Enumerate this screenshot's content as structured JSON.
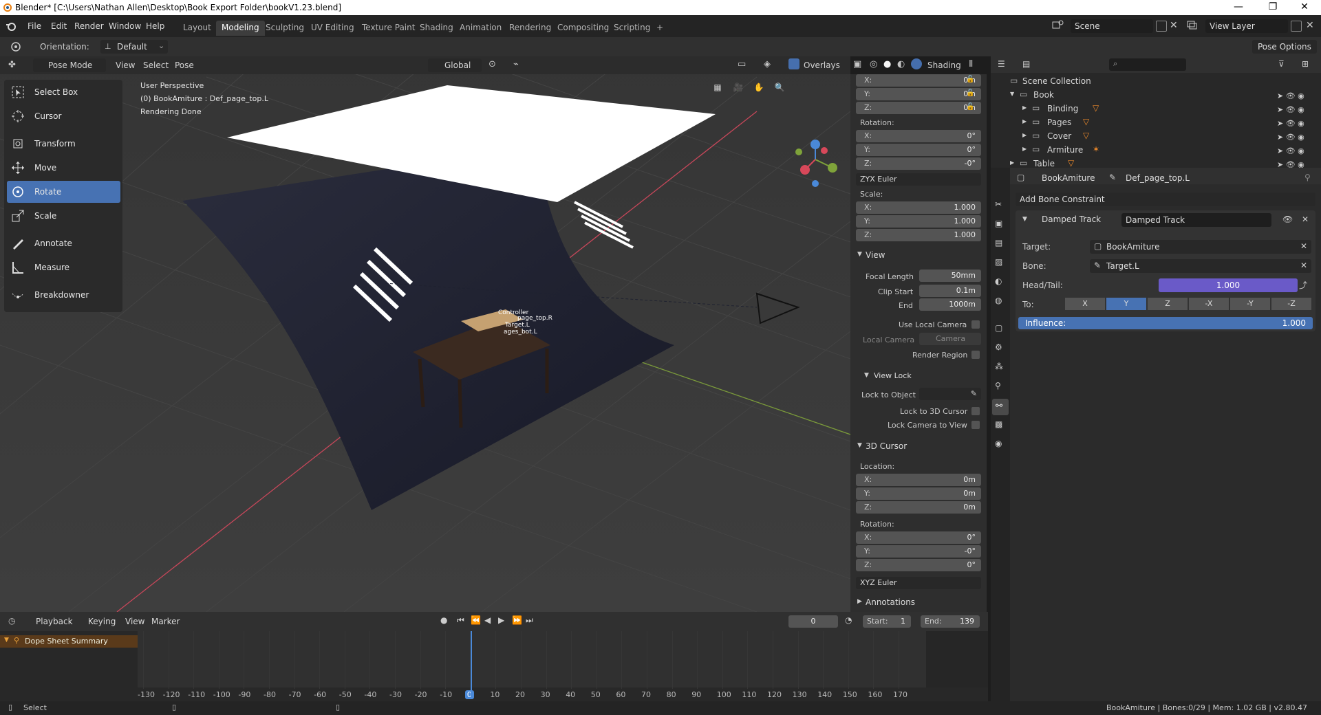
{
  "titlebar": {
    "title": "Blender* [C:\\Users\\Nathan Allen\\Desktop\\Book Export Folder\\bookV1.23.blend]",
    "minimize": "—",
    "maximize": "❐",
    "close": "✕"
  },
  "menus": [
    "File",
    "Edit",
    "Render",
    "Window",
    "Help"
  ],
  "workspaces": [
    "Layout",
    "Modeling",
    "Sculpting",
    "UV Editing",
    "Texture Paint",
    "Shading",
    "Animation",
    "Rendering",
    "Compositing",
    "Scripting",
    "+"
  ],
  "active_workspace": "Modeling",
  "scene_field": "Scene",
  "viewlayer_field": "View Layer",
  "toolsettings": {
    "orientation_label": "Orientation:",
    "orientation_value": "Default",
    "pose_options": "Pose Options"
  },
  "viewport_header": {
    "mode": "Pose Mode",
    "view": "View",
    "select": "Select",
    "pose": "Pose",
    "transform": "Global",
    "overlays": "Overlays",
    "shading": "Shading"
  },
  "viewport_info": {
    "line1": "User Perspective",
    "line2": "(0) BookAmiture : Def_page_top.L",
    "line3": "Rendering Done"
  },
  "bone_labels": {
    "l1": "Controller",
    "l2": "page_top.R",
    "l3": "Target.L",
    "l4": "ages_bot.L"
  },
  "tools": [
    {
      "label": "Select Box",
      "icon": "select-box-icon"
    },
    {
      "label": "Cursor",
      "icon": "cursor-icon"
    },
    {
      "label": "Transform",
      "icon": "transform-icon"
    },
    {
      "label": "Move",
      "icon": "move-icon"
    },
    {
      "label": "Rotate",
      "icon": "rotate-icon"
    },
    {
      "label": "Scale",
      "icon": "scale-icon"
    },
    {
      "label": "Annotate",
      "icon": "annotate-icon"
    },
    {
      "label": "Measure",
      "icon": "measure-icon"
    },
    {
      "label": "Breakdowner",
      "icon": "breakdowner-icon"
    }
  ],
  "active_tool": "Rotate",
  "npanel": {
    "loc": {
      "x": "0m",
      "y": "0m",
      "z": "0m"
    },
    "rotation_label": "Rotation:",
    "rot": {
      "x": "0°",
      "y": "0°",
      "z": "-0°"
    },
    "rot_mode": "ZYX Euler",
    "scale_label": "Scale:",
    "scale": {
      "x": "1.000",
      "y": "1.000",
      "z": "1.000"
    },
    "view_section": "View",
    "focal_length_label": "Focal Length",
    "focal_length": "50mm",
    "clip_start_label": "Clip Start",
    "clip_start": "0.1m",
    "end_label": "End",
    "end": "1000m",
    "use_local_camera": "Use Local Camera",
    "local_camera_label": "Local Camera",
    "local_camera_value": "Camera",
    "render_region": "Render Region",
    "view_lock": "View Lock",
    "lock_to_object": "Lock to Object",
    "lock_3d_cursor": "Lock to 3D Cursor",
    "lock_camera": "Lock Camera to View",
    "cursor_section": "3D Cursor",
    "location_label": "Location:",
    "cursor_loc": {
      "x": "0m",
      "y": "0m",
      "z": "0m"
    },
    "cursor_rot": {
      "x": "0°",
      "y": "-0°",
      "z": "0°"
    },
    "cursor_rot_mode": "XYZ Euler",
    "annotations": "Annotations"
  },
  "outliner": {
    "root": "Scene Collection",
    "items": [
      {
        "name": "Book"
      },
      {
        "name": "Binding"
      },
      {
        "name": "Pages"
      },
      {
        "name": "Cover"
      },
      {
        "name": "Armiture"
      },
      {
        "name": "Table"
      }
    ]
  },
  "props": {
    "object": "BookAmiture",
    "bone": "Def_page_top.L",
    "add_constraint": "Add Bone Constraint",
    "constraint_type": "Damped Track",
    "constraint_name": "Damped Track",
    "target_label": "Target:",
    "target_value": "BookAmiture",
    "bone_label": "Bone:",
    "bone_value": "Target.L",
    "headtail_label": "Head/Tail:",
    "headtail_value": "1.000",
    "to_label": "To:",
    "to_axes": [
      "X",
      "Y",
      "Z",
      "-X",
      "-Y",
      "-Z"
    ],
    "to_active": "Y",
    "influence_label": "Influence:",
    "influence_value": "1.000"
  },
  "timeline": {
    "playback": "Playback",
    "keying": "Keying",
    "view": "View",
    "marker": "Marker",
    "current_frame": "0",
    "start_label": "Start:",
    "start": "1",
    "end_label": "End:",
    "end": "139",
    "summary": "Dope Sheet Summary",
    "ticks": [
      "-130",
      "-120",
      "-110",
      "-100",
      "-90",
      "-80",
      "-70",
      "-60",
      "-50",
      "-40",
      "-30",
      "-20",
      "-10",
      "0",
      "10",
      "20",
      "30",
      "40",
      "50",
      "60",
      "70",
      "80",
      "90",
      "100",
      "110",
      "120",
      "130",
      "140",
      "150",
      "160",
      "170"
    ]
  },
  "status": {
    "left": "Select",
    "right": "BookAmiture | Bones:0/29 | Mem: 1.02 GB | v2.80.47"
  }
}
